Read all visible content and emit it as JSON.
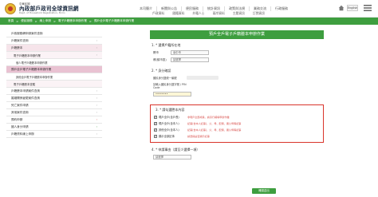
{
  "header": {
    "logo_top": "中華民國",
    "logo_main": "內政部戶政司全球資訊網",
    "logo_sub": "Dept. of Household Registration, M.O.I.",
    "nav_row1": [
      "本司簡介",
      "新聞與公告",
      "便民服務",
      "統計資訊",
      "政策與法規",
      "業務交流",
      "行政服務"
    ],
    "nav_row2": [
      "戶政資料",
      "國籍資料",
      "外籍人士",
      "兩岸資料",
      "主題資訊",
      "訂閱資訊"
    ],
    "lang_label": "English",
    "home_icon": "home-icon",
    "menu_icon": "menu-icon"
  },
  "breadcrumb": [
    "首頁",
    ">",
    "便民服務",
    ">",
    "線上申辦",
    ">",
    "電子戶籍謄本申辦作業",
    ">",
    "預戶全戶電子戶籍謄本申辦作業"
  ],
  "sidebar": {
    "items": [
      {
        "label": "戶政服務網申辦案件查詢",
        "style": "plain",
        "arrow": ""
      },
      {
        "label": "戶籍案件查詢",
        "style": "plain",
        "arrow": "›"
      },
      {
        "label": "戶籍謄本",
        "style": "pink",
        "arrow": "›"
      },
      {
        "label": "電子戶籍謄本申辦作業",
        "style": "sub",
        "arrow": "›"
      },
      {
        "label": "個人電子戶籍謄本申辦作業",
        "style": "sub2",
        "arrow": ""
      },
      {
        "label": "預戶全戶電子戶籍謄本申辦作業",
        "style": "hl",
        "arrow": ""
      },
      {
        "label": "其他全戶電子戶籍謄本申辦作業",
        "style": "sub2",
        "arrow": ""
      },
      {
        "label": "電子戶籍謄本查驗",
        "style": "sub",
        "arrow": ""
      },
      {
        "label": "戶籍謄本申請案件查詢",
        "style": "plain",
        "arrow": "›"
      },
      {
        "label": "婚姻關係變更案件查詢",
        "style": "plain",
        "arrow": "›"
      },
      {
        "label": "死亡案件申請",
        "style": "plain",
        "arrow": "›"
      },
      {
        "label": "其他案件查詢",
        "style": "plain",
        "arrow": "›"
      },
      {
        "label": "預約申辦",
        "style": "plain",
        "arrow": "›"
      },
      {
        "label": "國人身分申請",
        "style": "plain",
        "arrow": "›"
      },
      {
        "label": "戶籍資料線上申辦",
        "style": "plain",
        "arrow": "›"
      }
    ],
    "arrow_colors": [
      "#999999",
      "#d9534f",
      "#3e9e3f"
    ]
  },
  "main": {
    "title": "預戶全戶電子戶籍謄本申辦作業",
    "section1": {
      "title": "1. * 選擇戶籍所在地",
      "fields": [
        {
          "label": "縣市",
          "value": "臺中市"
        },
        {
          "label": "鄉(鎮市區)",
          "value": "請選擇"
        }
      ]
    },
    "section2": {
      "title": "2. * 身分確認",
      "fields": [
        {
          "label": "國民身分證統一編號",
          "value": ""
        },
        {
          "label": "請輸入國民身分證字號 / PIN Code",
          "value": "••••••••"
        }
      ]
    },
    "section3": {
      "title": "3. * 請勾選謄本內容",
      "options": [
        {
          "label": "現戶全戶(含戶長)",
          "note": "非現戶全部成員，請另行補填申辦作業"
        },
        {
          "label": "現戶全戶(含本人)",
          "note": "記事(含本人記事)，父、母、配偶、養父母等記事"
        },
        {
          "label": "其他全戶(含本人)",
          "note": "記事(含本人記事)，父、母、配偶、養父母等記事"
        },
        {
          "label": "顯示全部記事",
          "note": "請選擇是否顯示記事"
        }
      ]
    },
    "section4": {
      "title": "4. * 申請事由（請至少選擇一項）",
      "value": "請選擇"
    },
    "submit_label": "確認送出"
  },
  "colors": {
    "accent": "#3e9e3f",
    "highlight": "#d9342b",
    "sidebar_pink": "#f6e4ea",
    "sidebar_highlight": "#e9c2d2"
  }
}
